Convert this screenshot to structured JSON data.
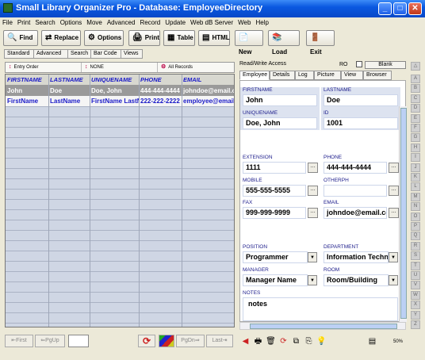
{
  "window": {
    "title": "Small Library Organizer Pro - Database: EmployeeDirectory",
    "minimize": "_",
    "maximize": "□",
    "close": "✕"
  },
  "menu": [
    "File",
    "Print",
    "Search",
    "Options",
    "Move",
    "Advanced",
    "Record",
    "Update",
    "Web dB Server",
    "Web",
    "Help"
  ],
  "toolbar": {
    "find": "Find",
    "replace": "Replace",
    "options": "Options",
    "print": "Print",
    "table": "Table",
    "html": "HTML",
    "new": "New",
    "load": "Load",
    "exit": "Exit"
  },
  "search_tabs": [
    "Standard",
    "Advanced",
    "Search",
    "Bar Code",
    "Views"
  ],
  "sort": {
    "entry_order": "Entry Order",
    "none": "NONE",
    "all_records": "All Records"
  },
  "grid": {
    "columns": [
      "FIRSTNAME",
      "LASTNAME",
      "UNIQUENAME",
      "PHONE",
      "EMAIL"
    ],
    "rows": [
      [
        "John",
        "Doe",
        "Doe, John",
        "444-444-4444",
        "johndoe@email.com"
      ],
      [
        "FirstName",
        "LastName",
        "FirstName LastName",
        "222-222-2222",
        "employee@email.com"
      ]
    ]
  },
  "nav": {
    "first": "First",
    "pgup": "PgUp",
    "pgdn": "PgDn",
    "last": "Last"
  },
  "right": {
    "access": "Read/Write Access",
    "ro": "RO",
    "blank": "Blank",
    "tabs": [
      "Employee",
      "Details",
      "Log",
      "Picture",
      "View",
      "Browser"
    ],
    "fields": {
      "firstname": {
        "label": "FIRSTNAME",
        "value": "John"
      },
      "lastname": {
        "label": "LASTNAME",
        "value": "Doe"
      },
      "uniquename": {
        "label": "UNIQUENAME",
        "value": "Doe, John"
      },
      "id": {
        "label": "ID",
        "value": "1001"
      },
      "extension": {
        "label": "EXTENSION",
        "value": "1111"
      },
      "phone": {
        "label": "PHONE",
        "value": "444-444-4444"
      },
      "mobile": {
        "label": "MOBILE",
        "value": "555-555-5555"
      },
      "otherph": {
        "label": "OTHERPH",
        "value": ""
      },
      "fax": {
        "label": "FAX",
        "value": "999-999-9999"
      },
      "email": {
        "label": "EMAIL",
        "value": "johndoe@email.com"
      },
      "position": {
        "label": "POSITION",
        "value": "Programmer"
      },
      "department": {
        "label": "DEPARTMENT",
        "value": "Information Technology"
      },
      "manager": {
        "label": "MANAGER",
        "value": "Manager Name"
      },
      "room": {
        "label": "ROOM",
        "value": "Room/Building"
      },
      "notes": {
        "label": "NOTES",
        "value": "notes"
      }
    }
  },
  "alphabet": [
    "A",
    "B",
    "C",
    "D",
    "E",
    "F",
    "G",
    "H",
    "I",
    "J",
    "K",
    "L",
    "M",
    "N",
    "O",
    "P",
    "Q",
    "R",
    "S",
    "T",
    "U",
    "V",
    "W",
    "X",
    "Y",
    "Z"
  ],
  "zoom": "50%",
  "colors": {
    "title": "#0a58e0",
    "grid_header_text": "#1a1ac8",
    "selected_row": "#9a9a9a"
  }
}
